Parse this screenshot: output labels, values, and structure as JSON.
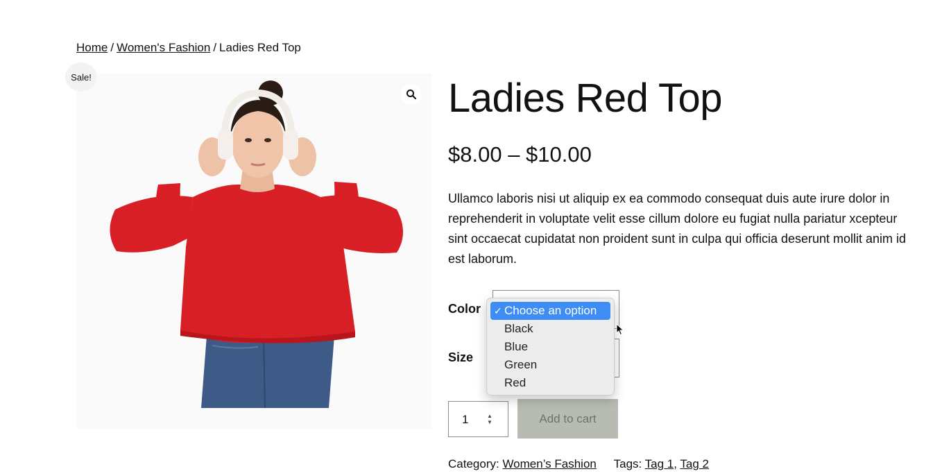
{
  "breadcrumb": {
    "home": "Home",
    "category": "Women's Fashion",
    "separator": "/",
    "current": "Ladies Red Top"
  },
  "gallery": {
    "sale_badge": "Sale!",
    "zoom_icon": "magnifier-icon"
  },
  "product": {
    "title": "Ladies Red Top",
    "price": "$8.00 – $10.00",
    "description": "Ullamco laboris nisi ut aliquip ex ea commodo consequat duis aute irure dolor in reprehenderit in voluptate velit esse cillum dolore eu fugiat nulla pariatur xcepteur sint occaecat cupidatat non proident sunt in culpa qui officia deserunt mollit anim id est laborum."
  },
  "variations": {
    "color_label": "Color",
    "size_label": "Size",
    "color_dropdown": {
      "options": [
        "Choose an option",
        "Black",
        "Blue",
        "Green",
        "Red"
      ],
      "selected": "Choose an option",
      "check_mark": "✓"
    }
  },
  "cart": {
    "quantity": "1",
    "add_to_cart_label": "Add to cart"
  },
  "meta": {
    "category_label": "Category:",
    "category_value": "Women’s Fashion",
    "tags_label": "Tags:",
    "tags": [
      "Tag 1",
      "Tag 2"
    ],
    "tag_separator": ","
  },
  "colors": {
    "dropdown_highlight": "#3d8df5",
    "add_to_cart_bg": "#b7bbb2",
    "sweater_red": "#d81f26"
  }
}
